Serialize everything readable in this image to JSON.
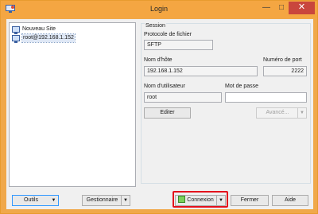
{
  "window": {
    "title": "Login",
    "minimize_icon": "—",
    "maximize_icon": "□",
    "close_icon": "✕"
  },
  "site_list": [
    {
      "label": "Nouveau Site"
    },
    {
      "label": "root@192.168.1.152",
      "selected": true
    }
  ],
  "session": {
    "group_title": "Session",
    "protocol_label": "Protocole de fichier",
    "protocol_value": "SFTP",
    "host_label": "Nom d'hôte",
    "host_value": "192.168.1.152",
    "port_label": "Numéro de port",
    "port_value": "2222",
    "user_label": "Nom d'utilisateur",
    "user_value": "root",
    "password_label": "Mot de passe",
    "password_value": "",
    "edit_button": "Editer",
    "advanced_button": "Avancé..."
  },
  "footer": {
    "tools_button": "Outils",
    "manager_button": "Gestionnaire",
    "connect_button": "Connexion",
    "close_button": "Fermer",
    "help_button": "Aide"
  },
  "colors": {
    "titlebar": "#f4a642",
    "close": "#c9463d",
    "highlight": "#e3101c"
  }
}
